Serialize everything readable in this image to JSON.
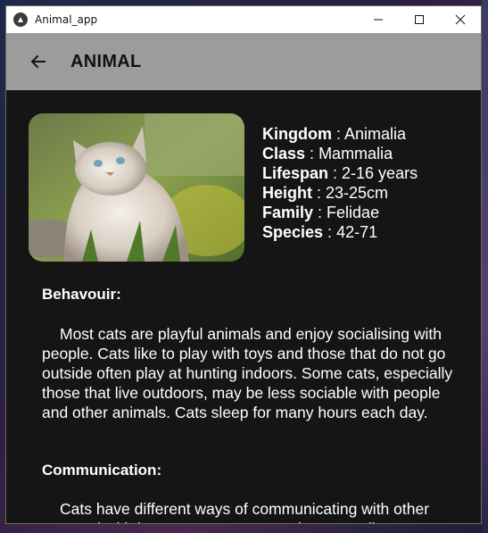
{
  "window": {
    "title": "Animal_app",
    "icons": {
      "app": "app-logo-icon",
      "minimize": "minimize-icon",
      "maximize": "maximize-icon",
      "close": "close-icon"
    }
  },
  "appbar": {
    "title": "ANIMAL",
    "back_icon": "arrow-left-icon",
    "color": "#9c9c9c"
  },
  "animal": {
    "image": "cat-photo",
    "facts": [
      {
        "label": "Kingdom",
        "sep": " : ",
        "value": "Animalia"
      },
      {
        "label": "Class",
        "sep": " : ",
        "value": "Mammalia"
      },
      {
        "label": "Lifespan",
        "sep": " : ",
        "value": "2-16 years"
      },
      {
        "label": "Height",
        "sep": " : ",
        "value": "23-25cm"
      },
      {
        "label": "Family",
        "sep": " : ",
        "value": "Felidae"
      },
      {
        "label": "Species",
        "sep": " : ",
        "value": "42-71"
      }
    ]
  },
  "sections": [
    {
      "title": "Behavouir:",
      "text": "Most cats are playful animals and enjoy socialising with people. Cats like to play with toys and those that do not go outside often play at hunting indoors. Some cats, especially those that live outdoors, may be less sociable with people and other animals. Cats sleep for many hours each day."
    },
    {
      "title": "Communication:",
      "text": "Cats have different ways of communicating with other cats and with humans. Cats communicate vocally"
    }
  ],
  "colors": {
    "background": "#151515",
    "text": "#ffffff"
  }
}
